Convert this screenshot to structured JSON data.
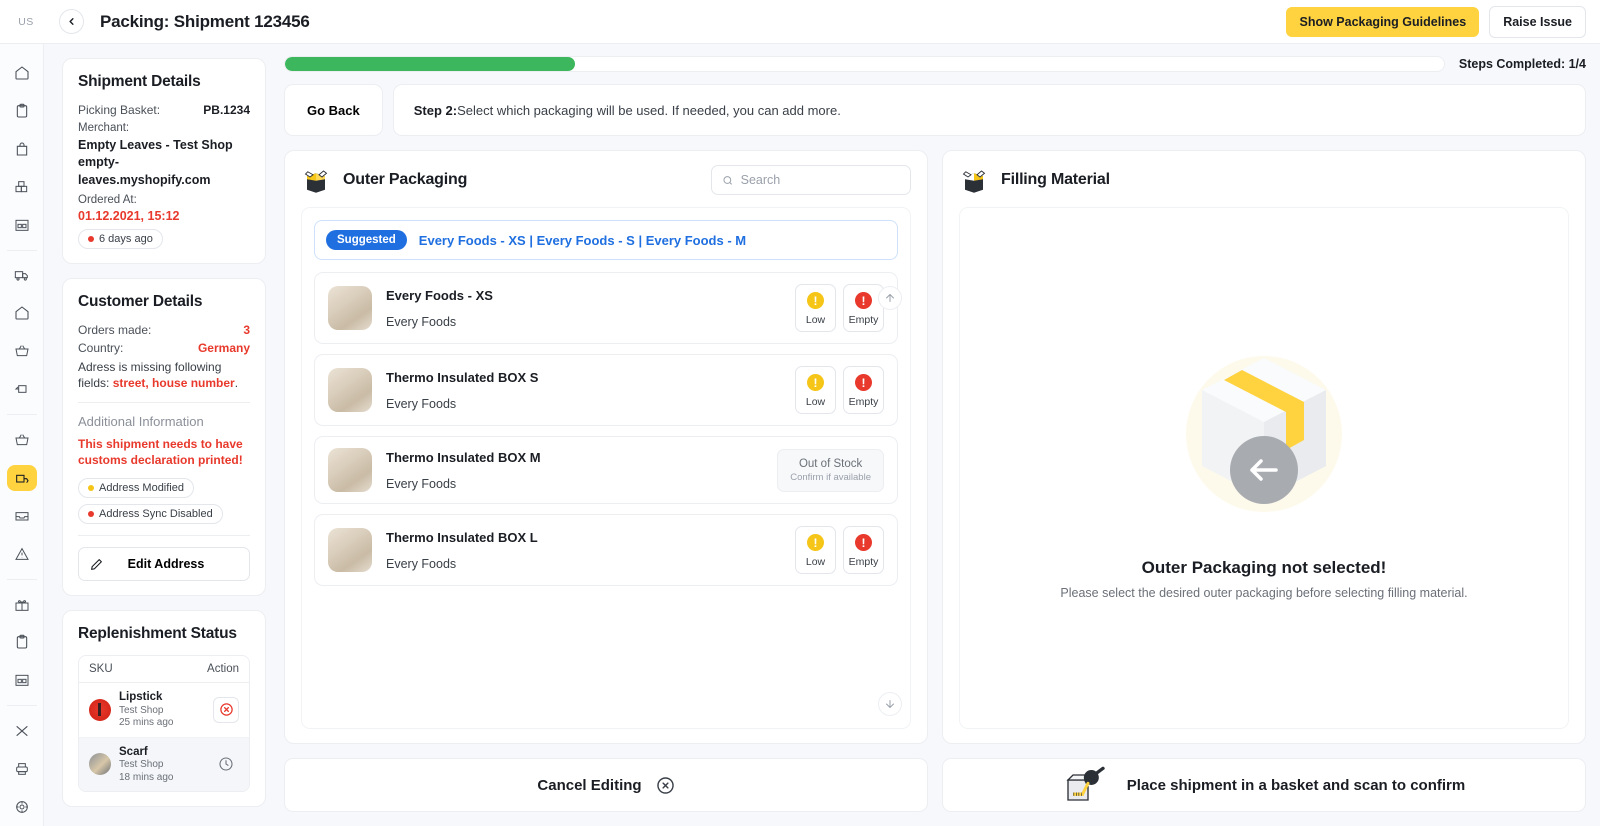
{
  "topbar": {
    "region_badge": "US",
    "back_icon": "chevron-left-icon",
    "title": "Packing: Shipment 123456",
    "primary_button": "Show Packaging Guidelines",
    "secondary_button": "Raise Issue",
    "accent_yellow": "#ffd23f"
  },
  "sidebar": {
    "items": [
      {
        "name": "home",
        "glyph": "home"
      },
      {
        "name": "clipboard",
        "glyph": "clipboard"
      },
      {
        "name": "bag",
        "glyph": "bag"
      },
      {
        "name": "boxes",
        "glyph": "boxes"
      },
      {
        "name": "warehouse",
        "glyph": "warehouse"
      },
      {
        "name": "truck",
        "glyph": "truck"
      },
      {
        "name": "home-2",
        "glyph": "home"
      },
      {
        "name": "basket",
        "glyph": "basket"
      },
      {
        "name": "return-box",
        "glyph": "return"
      },
      {
        "name": "basket-2",
        "glyph": "basket"
      },
      {
        "name": "packing-active",
        "glyph": "packing"
      },
      {
        "name": "inbox",
        "glyph": "inbox"
      },
      {
        "name": "alert",
        "glyph": "alert"
      },
      {
        "name": "gift",
        "glyph": "gift"
      },
      {
        "name": "clipboard-2",
        "glyph": "clipboard"
      },
      {
        "name": "warehouse-2",
        "glyph": "warehouse"
      },
      {
        "name": "shuffle",
        "glyph": "shuffle"
      },
      {
        "name": "printer",
        "glyph": "printer"
      },
      {
        "name": "settings",
        "glyph": "settings"
      }
    ]
  },
  "shipment_details": {
    "title": "Shipment Details",
    "picking_basket_label": "Picking Basket:",
    "picking_basket_value": "PB.1234",
    "merchant_label": "Merchant:",
    "merchant_name": "Empty Leaves - Test Shop",
    "merchant_domain": "empty-leaves.myshopify.com",
    "ordered_at_label": "Ordered At:",
    "ordered_at_value": "01.12.2021, 15:12",
    "ordered_ago": "6 days ago",
    "ordered_ago_dot_color": "#e8392c"
  },
  "customer_details": {
    "title": "Customer Details",
    "orders_made_label": "Orders made:",
    "orders_made_value": "3",
    "country_label": "Country:",
    "country_value": "Germany",
    "address_missing_prefix": "Adress is missing following fields: ",
    "address_missing_fields": "street, house number",
    "address_missing_suffix": ".",
    "additional_information_title": "Additional Information",
    "customs_warning": "This shipment needs to have customs declaration printed!",
    "tags": [
      {
        "label": "Address Modified",
        "dot": "#f5c518"
      },
      {
        "label": "Address Sync Disabled",
        "dot": "#e8392c"
      }
    ],
    "edit_button": "Edit Address",
    "edit_icon": "pencil-icon"
  },
  "replenishment": {
    "title": "Replenishment Status",
    "columns": [
      "SKU",
      "Action"
    ],
    "rows": [
      {
        "name": "Lipstick",
        "shop": "Test Shop",
        "time": "25 mins ago",
        "action_icon": "cancel-circle-icon",
        "thumb": "lipstick"
      },
      {
        "name": "Scarf",
        "shop": "Test Shop",
        "time": "18 mins ago",
        "action_icon": "clock-icon",
        "thumb": "scarf"
      }
    ]
  },
  "progress": {
    "percent": 25,
    "steps_text": "Steps Completed: 1/4",
    "fill_color": "#3cb75e"
  },
  "step": {
    "go_back": "Go Back",
    "step_label": "Step 2:",
    "step_text": " Select which packaging will be used. If needed, you can add more."
  },
  "outer_packaging": {
    "icon": "open-box-icon",
    "title": "Outer Packaging",
    "search_placeholder": "Search",
    "search_value": "",
    "suggested_badge": "Suggested",
    "suggested_items": "Every Foods - XS | Every Foods - S | Every Foods - M",
    "scroll_up_icon": "arrow-up-icon",
    "scroll_down_icon": "arrow-down-icon",
    "items": [
      {
        "name": "Every Foods - XS",
        "merchant": "Every Foods",
        "status": "stock",
        "low_label": "Low",
        "empty_label": "Empty"
      },
      {
        "name": "Thermo Insulated BOX S",
        "merchant": "Every Foods",
        "status": "stock",
        "low_label": "Low",
        "empty_label": "Empty"
      },
      {
        "name": "Thermo Insulated BOX M",
        "merchant": "Every Foods",
        "status": "out_of_stock",
        "oos_label": "Out of Stock",
        "oos_sub": "Confirm if available"
      },
      {
        "name": "Thermo Insulated BOX L",
        "merchant": "Every Foods",
        "status": "stock",
        "low_label": "Low",
        "empty_label": "Empty"
      }
    ]
  },
  "filling_material": {
    "icon": "open-box-icon",
    "title": "Filling Material",
    "empty_illustration": "box-with-left-arrow-illustration",
    "empty_title": "Outer Packaging not selected!",
    "empty_sub": "Please select the desired outer packaging before selecting filling material."
  },
  "footer": {
    "cancel_label": "Cancel Editing",
    "cancel_icon": "close-circle-icon",
    "confirm_label": "Place shipment in a basket and scan to confirm",
    "confirm_icon": "basket-scanner-icon"
  }
}
